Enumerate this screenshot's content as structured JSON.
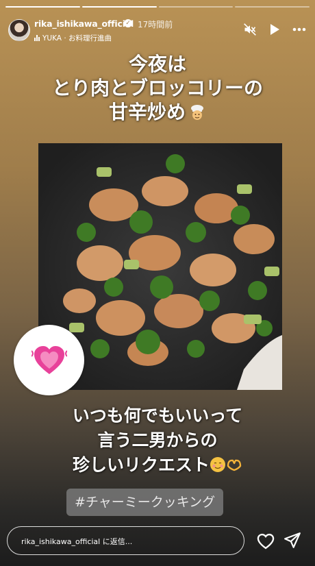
{
  "header": {
    "username": "rika_ishikawa_official",
    "time": "17時間前",
    "music": "YUKA · お料理行進曲"
  },
  "headline": {
    "line1": "今夜は",
    "line2": "とり肉とブロッコリーの",
    "line3": "甘辛炒め"
  },
  "caption": {
    "line1": "いつも何でもいいって",
    "line2": "言う二男からの",
    "line3": "珍しいリクエスト"
  },
  "hashtag": "#チャーミークッキング",
  "reply": {
    "placeholder": "rika_ishikawa_official に返信..."
  },
  "progress": {
    "segments": 4,
    "current": 2
  },
  "icons": {
    "mute": "muted-speaker-icon",
    "play": "play-icon",
    "more": "more-horizontal-icon",
    "like": "heart-outline-icon",
    "send": "paper-plane-icon",
    "sticker": "sparkling-heart-icon"
  },
  "colors": {
    "accent": "#e0408f",
    "overlay_text": "#ffffff"
  }
}
